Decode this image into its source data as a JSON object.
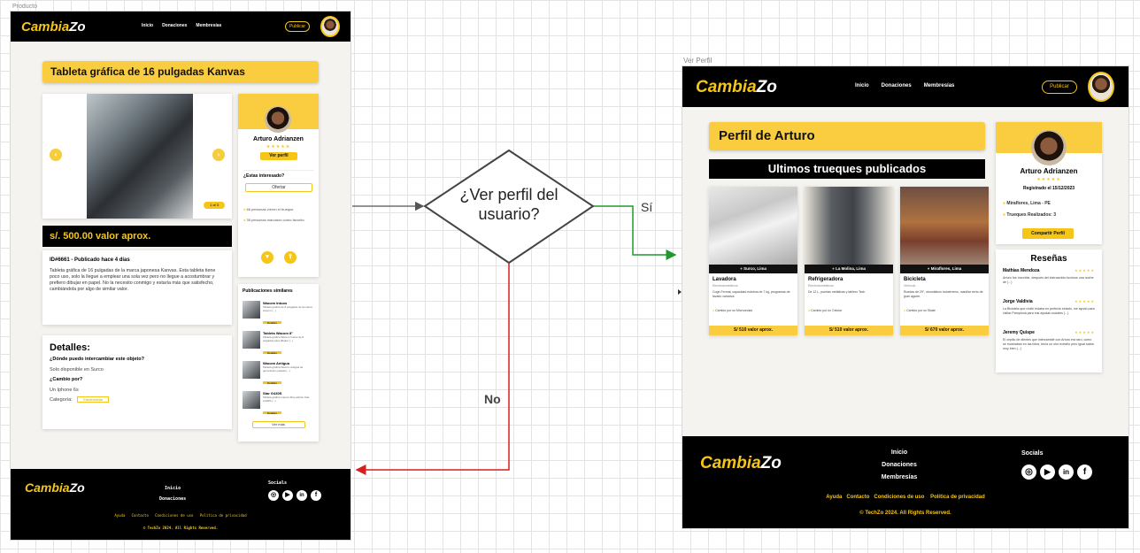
{
  "left": {
    "frame_label": "Producto",
    "nav": {
      "logo": "Cambia",
      "logo_suffix": "Zo",
      "links": [
        "Inicio",
        "Donaciones",
        "Membresías"
      ],
      "cta": "Publicar"
    },
    "title": "Tableta gráfica de 16 pulgadas Kanvas",
    "image_counter": "1 of 3",
    "seller": {
      "name": "Arturo Adrianzen",
      "stars": "★★★★★",
      "view_profile": "Ver perfil",
      "interest_q": "¿Estas interesado?",
      "offer": "Ofertar",
      "stat1": "66 personas vieron el trueque",
      "stat2": "35 personas marcaron como favorito"
    },
    "price": "s/. 500.00 valor aprox.",
    "meta": "ID#6661 - Publicado hace 4 días",
    "description": "Tableta gráfica de 16 pulgadas de la marca japonesa Kanvas. Esta tableta tiene poco uso, solo la llegue a emplear una sola vez pero no llegue a acostumbrar y prefiero dibujar en papel. No la necesito conmigo y estaría más que satisfecho, cambiándola por algo de similar valor.",
    "details": {
      "title": "Detalles:",
      "q1": "¿Dónde puedo intercambiar este objeto?",
      "a1": "Solo disponible en Surco",
      "q2": "¿Cambio por?",
      "a2": "Un Iphone 6s",
      "category_label": "Categoría:",
      "category_value": "Electrónicos"
    },
    "similar": {
      "title": "Publicaciones similares",
      "items": [
        {
          "name": "Wacom Intuos",
          "desc": "Tableta gráfica de 8 pulgadas de la marca wacom (...)",
          "btn": "Detalles"
        },
        {
          "name": "Tableta Wacom 8\"",
          "desc": "Tableta gráfica Wacom Intuos de 8 pulgadas para dibujar (...)",
          "btn": "Detalles"
        },
        {
          "name": "Wacom Antigua",
          "desc": "Tableta gráfica Wacom antigua de generación pasada (...)",
          "btn": "Detalles"
        },
        {
          "name": "Star G430S",
          "desc": "Tableta gráfica marca Ultra edición Star G430S (...)",
          "btn": "Detalles"
        }
      ],
      "more": "Ver más"
    },
    "footer": {
      "logo": "Cambia",
      "logo_suffix": "Zo",
      "links": [
        "Inicio",
        "Donaciones"
      ],
      "social_title": "Socials",
      "bottom_links": [
        "Ayuda",
        "Contacto",
        "Condiciones de uso",
        "Política de privacidad"
      ],
      "copy": "© TechZo 2024. All Rights Reserved."
    }
  },
  "flow": {
    "decision": "¿Ver perfil del usuario?",
    "yes": "Sí",
    "no": "No"
  },
  "right": {
    "frame_label": "Ver Perfil",
    "nav": {
      "logo": "Cambia",
      "logo_suffix": "Zo",
      "links": [
        "Inicio",
        "Donaciones",
        "Membresías"
      ],
      "cta": "Publicar"
    },
    "title": "Perfil de Arturo",
    "subtitle": "Ultimos trueques publicados",
    "items": [
      {
        "location": "Surco, Lima",
        "name": "Lavadora",
        "category": "Electrodomésticos",
        "desc": "Coge-Fermal, capacidad máxima de 7 kg, programas de lavado variados",
        "exchange": "Cambio por un Microondas",
        "price": "S/ 510 valor aprox."
      },
      {
        "location": "La Molina, Lima",
        "name": "Refrigeradora",
        "category": "Electrodomésticos",
        "desc": "De 12 L, puertas metálicas y tablero Tech",
        "exchange": "Cambio por un Celular",
        "price": "S/ 510 valor aprox."
      },
      {
        "location": "Miraflores, Lima",
        "name": "Bicicleta",
        "category": "Vehículo",
        "desc": "Ruedas de 29\", neumáticos todoterreno, manillar recto de gran agarre.",
        "exchange": "Cambio por un Skate",
        "price": "S/ 670 valor aprox."
      }
    ],
    "profile": {
      "name": "Arturo Adrianzen",
      "stars": "★★★★★",
      "registered": "Registrado el 15/12/2023",
      "location": "Miraflores, Lima - PE",
      "trades": "Trueques Realizados: 3",
      "share": "Compartir Perfil"
    },
    "reviews": {
      "title": "Reseñas",
      "items": [
        {
          "name": "Mathias Mendoza",
          "stars": "★★★★★",
          "text": "Arturo fue increíble, después del intercambio tuvimos una noche de (...)"
        },
        {
          "name": "Jorge Valdivia",
          "stars": "★★★★★",
          "text": "La Bicicleta que recibí estaba en perfecto estado, me ayudó para visitar Pamplona para mis ayudas sociales (...)"
        },
        {
          "name": "Jeremy Quispe",
          "stars": "★★★★★",
          "text": "El cepillo de dientes que intercambié con Arturo era raro, como se mostraban en las fotos, tenía un olor extraño pero igual sabía muy bien (...)"
        }
      ]
    },
    "footer": {
      "logo": "Cambia",
      "logo_suffix": "Zo",
      "links": [
        "Inicio",
        "Donaciones",
        "Membresías"
      ],
      "social_title": "Socials",
      "bottom_links": [
        "Ayuda",
        "Contacto",
        "Condiciones de uso",
        "Política de privacidad"
      ],
      "copy": "© TechZo 2024. All Rights Reserved."
    }
  },
  "colors": {
    "accent": "#f5c518",
    "banner": "#f9cd3f",
    "yes_arrow": "#1f9a2e",
    "no_arrow": "#d61f1f",
    "line": "#555555"
  }
}
